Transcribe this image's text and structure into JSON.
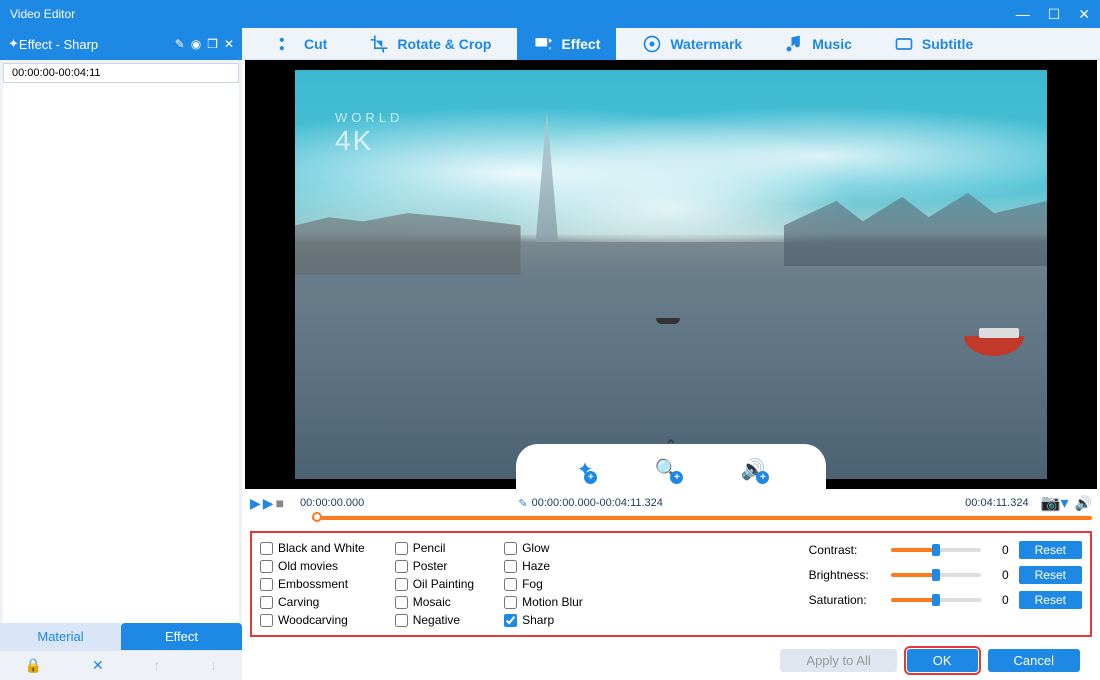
{
  "window": {
    "title": "Video Editor"
  },
  "panel": {
    "title": "Effect - Sharp",
    "clip_time": "00:00:00-00:04:11"
  },
  "side_tabs": {
    "material": "Material",
    "effect": "Effect"
  },
  "ribbon": {
    "cut": "Cut",
    "rotate": "Rotate & Crop",
    "effect": "Effect",
    "watermark": "Watermark",
    "music": "Music",
    "subtitle": "Subtitle"
  },
  "preview_watermark": {
    "line1": "WORLD",
    "line2": "4K"
  },
  "timeline": {
    "start": "00:00:00.000",
    "range": "00:00:00.000-00:04:11.324",
    "end": "00:04:11.324"
  },
  "effects": {
    "col1": [
      "Black and White",
      "Old movies",
      "Embossment",
      "Carving",
      "Woodcarving"
    ],
    "col2": [
      "Pencil",
      "Poster",
      "Oil Painting",
      "Mosaic",
      "Negative"
    ],
    "col3": [
      "Glow",
      "Haze",
      "Fog",
      "Motion Blur",
      "Sharp"
    ],
    "selected": "Sharp"
  },
  "adjustments": {
    "contrast": {
      "label": "Contrast:",
      "value": "0"
    },
    "brightness": {
      "label": "Brightness:",
      "value": "0"
    },
    "saturation": {
      "label": "Saturation:",
      "value": "0"
    },
    "reset_label": "Reset"
  },
  "footer": {
    "apply_all": "Apply to All",
    "ok": "OK",
    "cancel": "Cancel"
  }
}
